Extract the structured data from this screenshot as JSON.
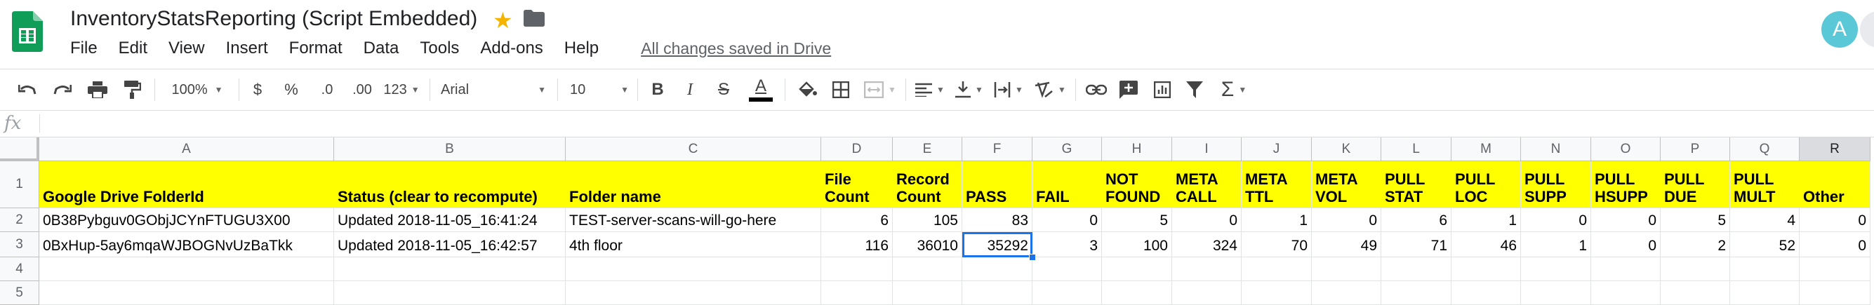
{
  "app": {
    "title": "InventoryStatsReporting (Script Embedded)",
    "save_status": "All changes saved in Drive",
    "avatar_letter": "A",
    "accent_color": "#0f9d58"
  },
  "menu": [
    "File",
    "Edit",
    "View",
    "Insert",
    "Format",
    "Data",
    "Tools",
    "Add-ons",
    "Help"
  ],
  "toolbar": {
    "zoom": "100%",
    "currency": "$",
    "percent": "%",
    "decrease_decimals": ".0",
    "increase_decimals": ".00",
    "more_formats": "123",
    "font": "Arial",
    "font_size": "10",
    "bold": "B",
    "italic": "I",
    "strikethrough": "S",
    "text_color": "A",
    "function_symbol": "Σ"
  },
  "formula_bar": {
    "fx": "fx",
    "value": ""
  },
  "grid": {
    "columns": [
      "A",
      "B",
      "C",
      "D",
      "E",
      "F",
      "G",
      "H",
      "I",
      "J",
      "K",
      "L",
      "M",
      "N",
      "O",
      "P",
      "Q",
      "R"
    ],
    "selected_column": "R",
    "rows": [
      "1",
      "2",
      "3",
      "4",
      "5"
    ],
    "header": [
      "Google Drive FolderId",
      "Status (clear to recompute)",
      "Folder name",
      "File Count",
      "Record Count",
      "PASS",
      "FAIL",
      "NOT FOUND",
      "META CALL",
      "META TTL",
      "META VOL",
      "PULL STAT",
      "PULL LOC",
      "PULL SUPP",
      "PULL HSUPP",
      "PULL DUE",
      "PULL MULT",
      "Other"
    ],
    "data": [
      [
        "0B38Pybguv0GObjJCYnFTUGU3X00",
        "Updated 2018-11-05_16:41:24",
        "TEST-server-scans-will-go-here",
        "6",
        "105",
        "83",
        "0",
        "5",
        "0",
        "1",
        "0",
        "6",
        "1",
        "0",
        "0",
        "5",
        "4",
        "0"
      ],
      [
        "0BxHup-5ay6mqaWJBOGNvUzBaTkk",
        "Updated 2018-11-05_16:42:57",
        "4th floor",
        "116",
        "36010",
        "35292",
        "3",
        "100",
        "324",
        "70",
        "49",
        "71",
        "46",
        "1",
        "0",
        "2",
        "52",
        "0"
      ]
    ],
    "active_cell": "F3",
    "header_fill": "#ffff00",
    "selection_color": "#1a73e8"
  }
}
